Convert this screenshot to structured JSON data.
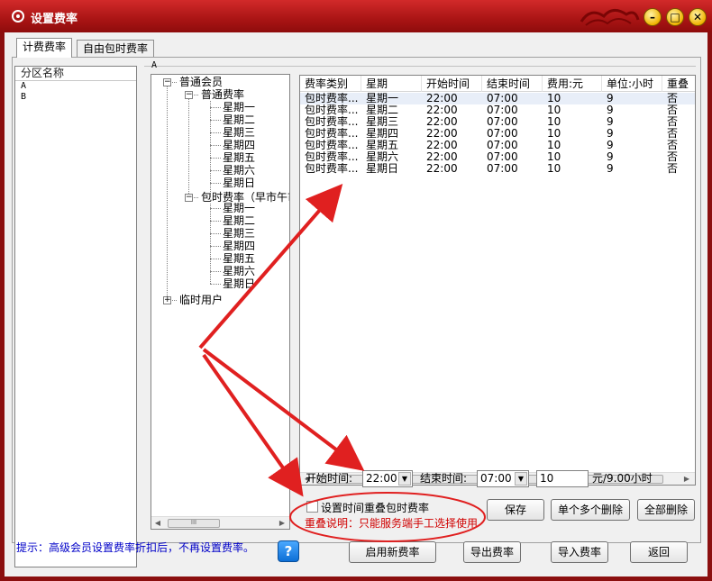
{
  "window": {
    "title": "设置费率",
    "minimize": "–",
    "maximize": "□",
    "close": "✕"
  },
  "tabs": [
    {
      "label": "计费费率"
    },
    {
      "label": "自由包时费率"
    }
  ],
  "zone_list": {
    "header": "分区名称",
    "items": [
      "A",
      "B"
    ]
  },
  "group_label": "A",
  "tree": {
    "root1": "普通会员",
    "child1": "普通费率",
    "child1_days": [
      "星期一",
      "星期二",
      "星期三",
      "星期四",
      "星期五",
      "星期六",
      "星期日"
    ],
    "child2": "包时费率（早市午市",
    "child2_days": [
      "星期一",
      "星期二",
      "星期三",
      "星期四",
      "星期五",
      "星期六",
      "星期日"
    ],
    "root2": "临时用户",
    "scroll_thumb": "III"
  },
  "grid": {
    "columns": [
      "费率类别",
      "星期",
      "开始时间",
      "结束时间",
      "费用:元",
      "单位:小时",
      "重叠"
    ],
    "rows": [
      [
        "包时费率...",
        "星期一",
        "22:00",
        "07:00",
        "10",
        "9",
        "否"
      ],
      [
        "包时费率...",
        "星期二",
        "22:00",
        "07:00",
        "10",
        "9",
        "否"
      ],
      [
        "包时费率...",
        "星期三",
        "22:00",
        "07:00",
        "10",
        "9",
        "否"
      ],
      [
        "包时费率...",
        "星期四",
        "22:00",
        "07:00",
        "10",
        "9",
        "否"
      ],
      [
        "包时费率...",
        "星期五",
        "22:00",
        "07:00",
        "10",
        "9",
        "否"
      ],
      [
        "包时费率...",
        "星期六",
        "22:00",
        "07:00",
        "10",
        "9",
        "否"
      ],
      [
        "包时费率...",
        "星期日",
        "22:00",
        "07:00",
        "10",
        "9",
        "否"
      ]
    ],
    "scroll_thumb": "III"
  },
  "form": {
    "start_label": "开始时间:",
    "start_value": "22:00",
    "end_label": "结束时间:",
    "end_value": "07:00",
    "fee_value": "10",
    "unit_text": "元/9.00小时",
    "overlap_checkbox_label": "设置时间重叠包时费率",
    "overlap_note": "重叠说明：只能服务端手工选择使用"
  },
  "buttons": {
    "save": "保存",
    "delete_selected": "单个多个删除",
    "delete_all": "全部删除",
    "enable_new": "启用新费率",
    "export": "导出费率",
    "import": "导入费率",
    "back": "返回"
  },
  "tip": "提示：高级会员设置费率折扣后，不再设置费率。",
  "help_icon": "?",
  "colors": {
    "title_bar": "#b61a1a",
    "annotation_red": "#e02020",
    "tip_blue": "#0000c8",
    "note_red": "#d00000"
  }
}
